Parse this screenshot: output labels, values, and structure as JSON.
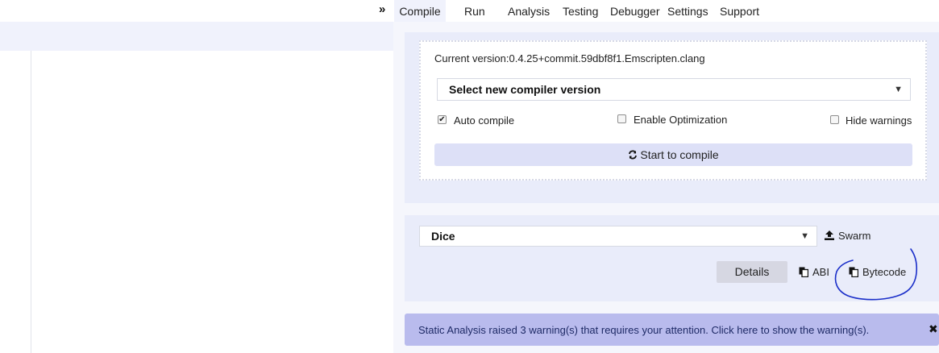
{
  "toggle": {
    "glyph": "»"
  },
  "tabs": [
    {
      "label": "Compile",
      "active": true
    },
    {
      "label": "Run"
    },
    {
      "label": "Analysis"
    },
    {
      "label": "Testing"
    },
    {
      "label": "Debugger"
    },
    {
      "label": "Settings"
    },
    {
      "label": "Support"
    }
  ],
  "compiler": {
    "current_version": "Current version:0.4.25+commit.59dbf8f1.Emscripten.clang",
    "select_label": "Select new compiler version",
    "auto_compile": {
      "label": "Auto compile",
      "checked": true
    },
    "enable_optimization": {
      "label": "Enable Optimization",
      "checked": false
    },
    "hide_warnings": {
      "label": "Hide warnings",
      "checked": false
    },
    "compile_button": "Start to compile",
    "compile_icon": "refresh-icon"
  },
  "contract": {
    "selected": "Dice",
    "swarm_label": "Swarm",
    "details_label": "Details",
    "abi_label": "ABI",
    "bytecode_label": "Bytecode"
  },
  "warning": {
    "text": "Static Analysis raised 3 warning(s) that requires your attention. Click here to show the warning(s).",
    "close_glyph": "✖"
  },
  "colors": {
    "panel_bg": "#f5f6fc",
    "box_bg": "#e9ecfa",
    "compile_button_bg": "#dde0f7",
    "warning_bg": "#b9bbed",
    "annotation_ink": "#1b2fc9"
  }
}
